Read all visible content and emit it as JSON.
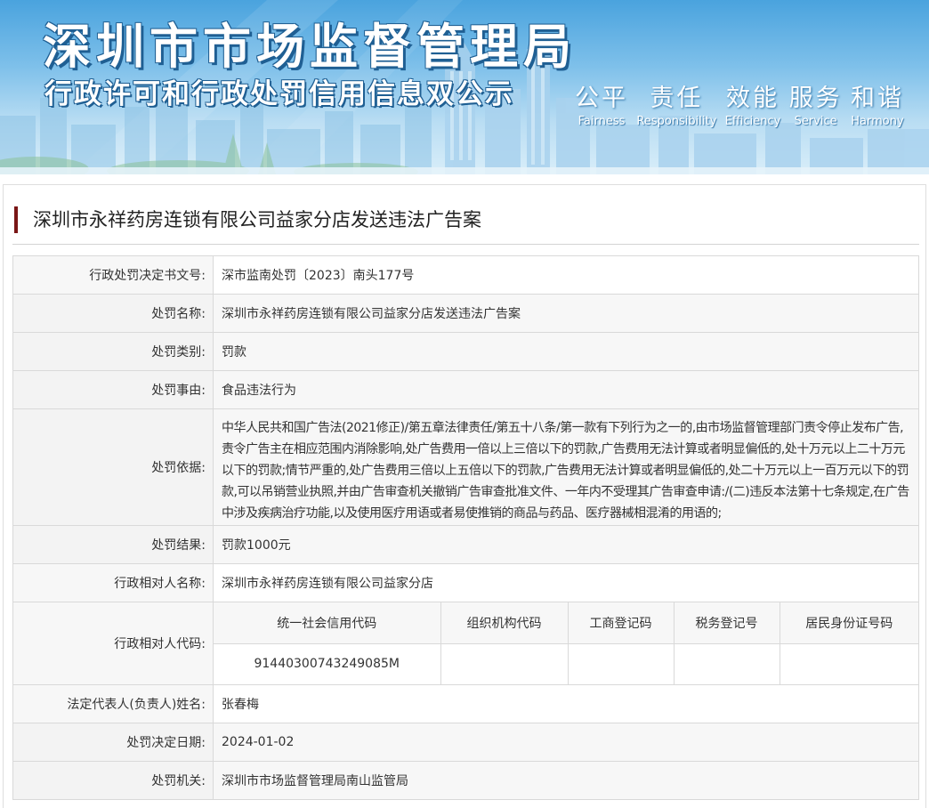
{
  "banner": {
    "title": "深圳市市场监督管理局",
    "subtitle": "行政许可和行政处罚信用信息双公示",
    "values": [
      {
        "zh": "公平",
        "en": "Fairness"
      },
      {
        "zh": "责任",
        "en": "Responsibility"
      },
      {
        "zh": "效能",
        "en": "Efficiency"
      },
      {
        "zh": "服务",
        "en": "Service"
      },
      {
        "zh": "和谐",
        "en": "Harmony"
      }
    ],
    "colors": {
      "sky_top": "#4aa3de",
      "sky_bottom": "#d9eef9",
      "text_outline": "#1f5f93"
    }
  },
  "case": {
    "title": "深圳市永祥药房连锁有限公司益家分店发送违法广告案",
    "accent_color": "#7a1616"
  },
  "fields": {
    "decision_no": {
      "label": "行政处罚决定书文号:",
      "value": "深市监南处罚〔2023〕南头177号"
    },
    "penalty_name": {
      "label": "处罚名称:",
      "value": "深圳市永祥药房连锁有限公司益家分店发送违法广告案"
    },
    "penalty_type": {
      "label": "处罚类别:",
      "value": "罚款"
    },
    "penalty_reason": {
      "label": "处罚事由:",
      "value": "食品违法行为"
    },
    "penalty_basis": {
      "label": "处罚依据:",
      "value": "中华人民共和国广告法(2021修正)/第五章法律责任/第五十八条/第一款有下列行为之一的,由市场监督管理部门责令停止发布广告,责令广告主在相应范围内消除影响,处广告费用一倍以上三倍以下的罚款,广告费用无法计算或者明显偏低的,处十万元以上二十万元以下的罚款;情节严重的,处广告费用三倍以上五倍以下的罚款,广告费用无法计算或者明显偏低的,处二十万元以上一百万元以下的罚款,可以吊销营业执照,并由广告审查机关撤销广告审查批准文件、一年内不受理其广告审查申请:/(二)违反本法第十七条规定,在广告中涉及疾病治疗功能,以及使用医疗用语或者易使推销的商品与药品、医疗器械相混淆的用语的;"
    },
    "penalty_result": {
      "label": "处罚结果:",
      "value": "罚款1000元"
    },
    "party_name": {
      "label": "行政相对人名称:",
      "value": "深圳市永祥药房连锁有限公司益家分店"
    },
    "party_code": {
      "label": "行政相对人代码:",
      "headers": [
        "统一社会信用代码",
        "组织机构代码",
        "工商登记码",
        "税务登记号",
        "居民身份证号码"
      ],
      "values": [
        "91440300743249085M",
        "",
        "",
        "",
        ""
      ]
    },
    "legal_rep": {
      "label": "法定代表人(负责人)姓名:",
      "value": "张春梅"
    },
    "decision_date": {
      "label": "处罚决定日期:",
      "value": "2024-01-02"
    },
    "authority": {
      "label": "处罚机关:",
      "value": "深圳市市场监督管理局南山监管局"
    }
  }
}
